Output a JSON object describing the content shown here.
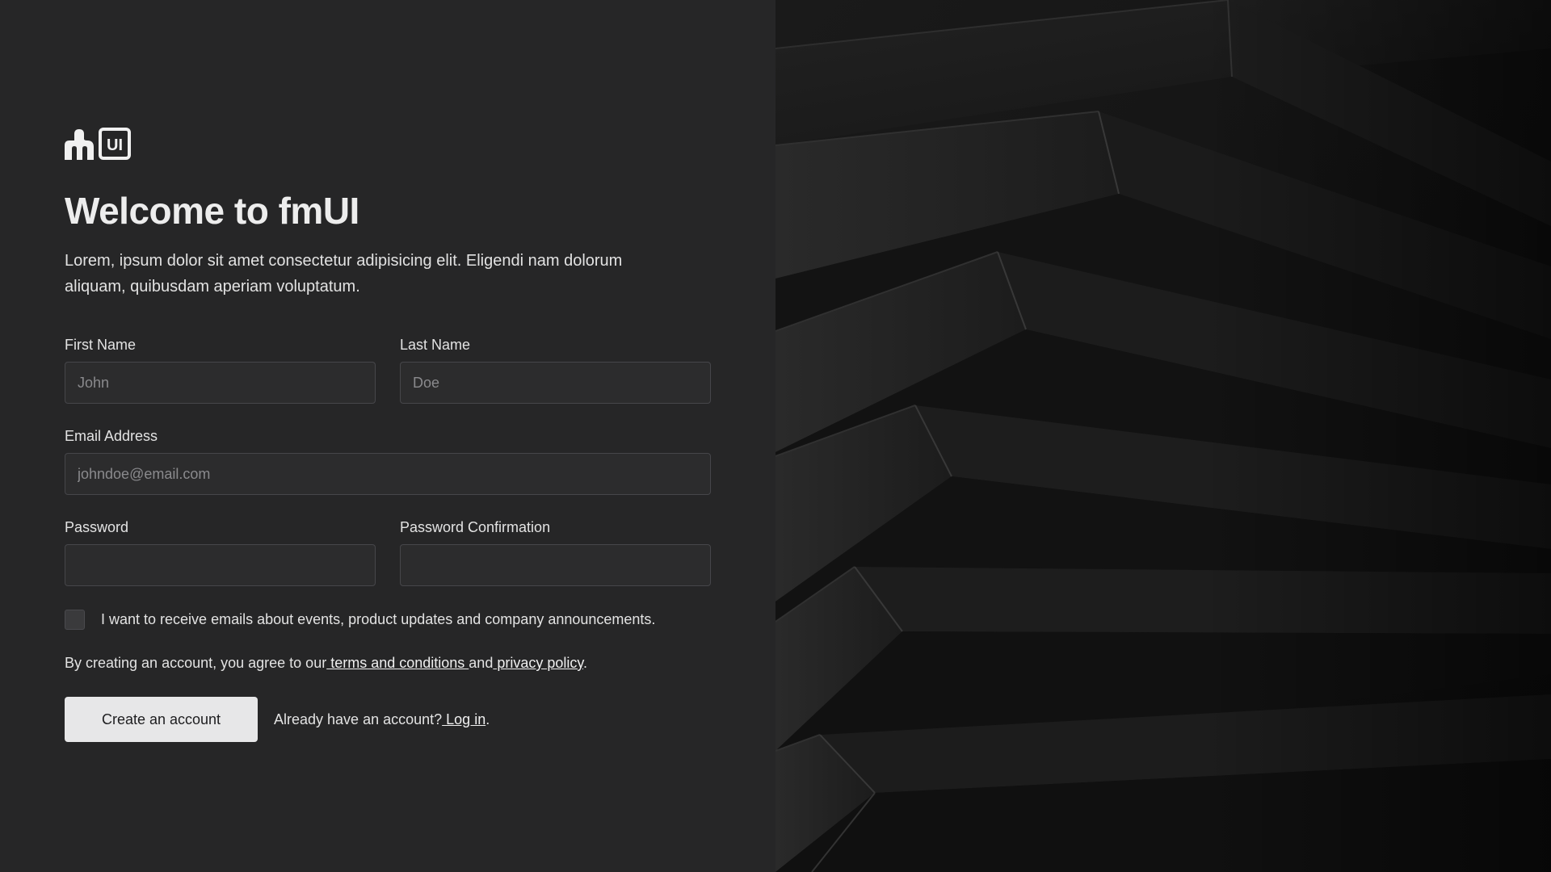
{
  "brand": {
    "logo_icon": "fm-ui-logo",
    "logo_badge_text": "UI"
  },
  "header": {
    "title": "Welcome to fmUI",
    "subtitle": "Lorem, ipsum dolor sit amet consectetur adipisicing elit. Eligendi nam dolorum aliquam, quibusdam aperiam voluptatum."
  },
  "form": {
    "first_name": {
      "label": "First Name",
      "placeholder": "John",
      "value": ""
    },
    "last_name": {
      "label": "Last Name",
      "placeholder": "Doe",
      "value": ""
    },
    "email": {
      "label": "Email Address",
      "placeholder": "johndoe@email.com",
      "value": ""
    },
    "password": {
      "label": "Password",
      "placeholder": "",
      "value": ""
    },
    "password_confirmation": {
      "label": "Password Confirmation",
      "placeholder": "",
      "value": ""
    },
    "marketing_opt_in": {
      "label": "I want to receive emails about events, product updates and company announcements.",
      "checked": false
    },
    "terms": {
      "prefix": "By creating an account, you agree to our",
      "terms_link": " terms and conditions ",
      "middle": "and",
      "privacy_link": " privacy policy",
      "suffix": "."
    },
    "submit_label": "Create an account",
    "login": {
      "prefix": "Already have an account?",
      "link": " Log in",
      "suffix": "."
    }
  },
  "colors": {
    "left_background": "#262627",
    "right_background": "#151515",
    "button_background": "#e7e7e8",
    "text": "#e3e3e3"
  }
}
